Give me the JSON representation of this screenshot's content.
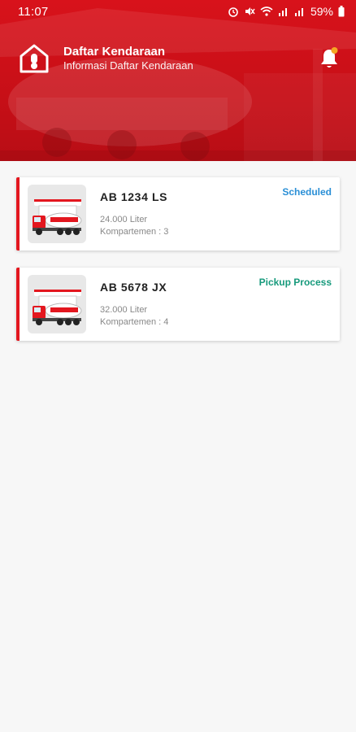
{
  "status_bar": {
    "time": "11:07",
    "battery": "59%"
  },
  "header": {
    "title": "Daftar Kendaraan",
    "subtitle": "Informasi Daftar Kendaraan",
    "icons": [
      "home-icon",
      "bell-icon"
    ],
    "colors": {
      "brand_red": "#d8121b",
      "badge": "#f5a623"
    }
  },
  "vehicles": [
    {
      "plate": "AB 1234 LS",
      "capacity": "24.000 Liter",
      "compartments": "Kompartemen : 3",
      "status": "Scheduled",
      "status_color": "#2a8fd6"
    },
    {
      "plate": "AB 5678 JX",
      "capacity": "32.000 Liter",
      "compartments": "Kompartemen : 4",
      "status": "Pickup Process",
      "status_color": "#179a7c"
    }
  ]
}
